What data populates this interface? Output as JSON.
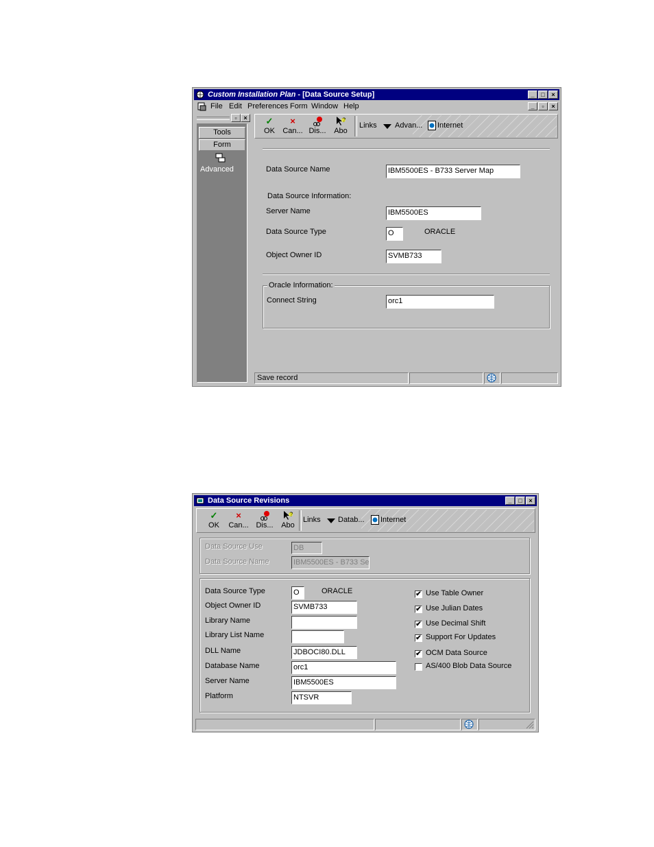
{
  "window1": {
    "title_italic": "Custom Installation Plan",
    "title_rest": " - [Data Source Setup]",
    "menu": [
      "File",
      "Edit",
      "Preferences",
      "Form",
      "Window",
      "Help"
    ],
    "sidebar": {
      "tools_label": "Tools",
      "form_label": "Form",
      "advanced_label": "Advanced"
    },
    "toolbar": {
      "ok": "OK",
      "cancel": "Can...",
      "display": "Dis...",
      "about": "Abo",
      "links": "Links",
      "advanced": "Advan...",
      "internet": "Internet"
    },
    "form": {
      "data_source_name_label": "Data Source Name",
      "data_source_name_value": "IBM5500ES - B733 Server Map",
      "group1_title": "Data Source Information:",
      "server_name_label": "Server Name",
      "server_name_value": "IBM5500ES",
      "ds_type_label": "Data Source Type",
      "ds_type_value": "O",
      "ds_type_desc": "ORACLE",
      "owner_label": "Object Owner ID",
      "owner_value": "SVMB733",
      "group2_title": "Oracle Information:",
      "connect_label": "Connect String",
      "connect_value": "orc1"
    },
    "status": "Save record"
  },
  "window2": {
    "title": "Data Source Revisions",
    "toolbar": {
      "ok": "OK",
      "cancel": "Can...",
      "display": "Dis...",
      "about": "Abo",
      "links": "Links",
      "database": "Datab...",
      "internet": "Internet"
    },
    "top": {
      "use_label": "Data Source Use",
      "use_value": "DB",
      "name_label": "Data Source Name",
      "name_value": "IBM5500ES - B733 Se"
    },
    "fields": {
      "type_label": "Data Source Type",
      "type_value": "O",
      "type_desc": "ORACLE",
      "owner_label": "Object Owner ID",
      "owner_value": "SVMB733",
      "library_label": "Library Name",
      "library_value": "",
      "liblist_label": "Library List Name",
      "liblist_value": "",
      "dll_label": "DLL Name",
      "dll_value": "JDBOCI80.DLL",
      "dbname_label": "Database Name",
      "dbname_value": "orc1",
      "server_label": "Server Name",
      "server_value": "IBM5500ES",
      "platform_label": "Platform",
      "platform_value": "NTSVR"
    },
    "checks": {
      "table_owner": {
        "label": "Use Table Owner",
        "checked": "✔"
      },
      "julian": {
        "label": "Use Julian Dates",
        "checked": "✔"
      },
      "decimal": {
        "label": "Use Decimal Shift",
        "checked": "✔"
      },
      "updates": {
        "label": "Support For Updates",
        "checked": "✔"
      },
      "ocm": {
        "label": "OCM Data Source",
        "checked": "✔"
      },
      "blob": {
        "label": "AS/400 Blob Data Source",
        "checked": ""
      }
    }
  }
}
